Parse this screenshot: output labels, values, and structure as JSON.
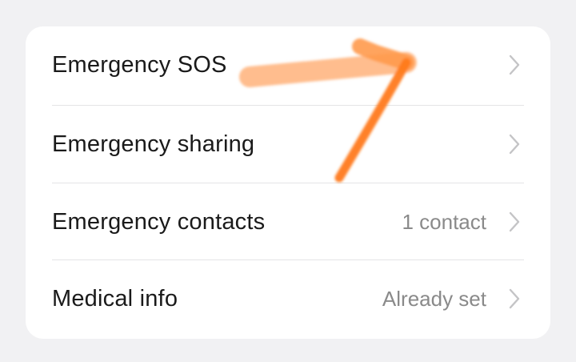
{
  "settings_list": {
    "items": [
      {
        "label": "Emergency SOS",
        "value": ""
      },
      {
        "label": "Emergency sharing",
        "value": ""
      },
      {
        "label": "Emergency contacts",
        "value": "1 contact"
      },
      {
        "label": "Medical info",
        "value": "Already set"
      }
    ]
  },
  "icons": {
    "row_chevron": "chevron-right-icon",
    "annotation": "orange-hand-drawn-arrow"
  },
  "colors": {
    "background": "#f1f1f3",
    "card": "#ffffff",
    "label_text": "#1a1a1a",
    "value_text": "#8a8a8a",
    "chevron": "#c4c4c6",
    "annotation_orange": "#ff7a1a"
  }
}
